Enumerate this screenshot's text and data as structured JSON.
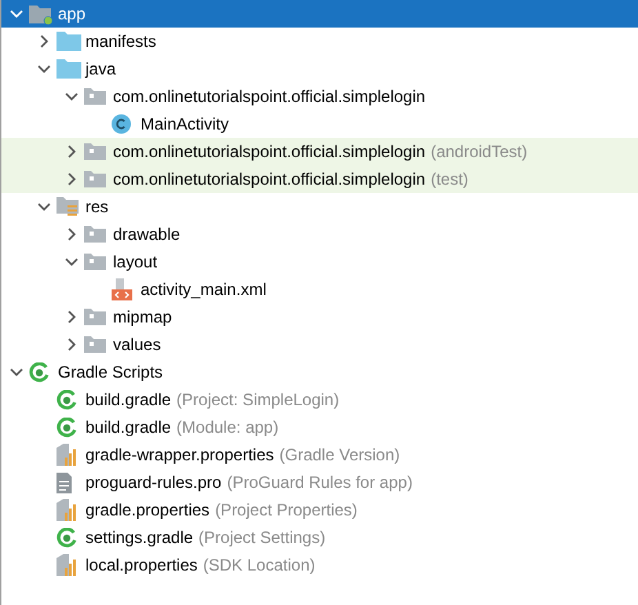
{
  "tree": [
    {
      "label": "app",
      "kind": "module",
      "expanded": true,
      "selected": true,
      "tinted": false,
      "children": [
        {
          "label": "manifests",
          "kind": "source-folder",
          "expanded": false,
          "selected": false,
          "tinted": false
        },
        {
          "label": "java",
          "kind": "source-folder",
          "expanded": true,
          "selected": false,
          "tinted": false,
          "children": [
            {
              "label": "com.onlinetutorialspoint.official.simplelogin",
              "kind": "package",
              "expanded": true,
              "selected": false,
              "tinted": false,
              "children": [
                {
                  "label": "MainActivity",
                  "kind": "class",
                  "selected": false,
                  "tinted": false
                }
              ]
            },
            {
              "label": "com.onlinetutorialspoint.official.simplelogin",
              "hint": "(androidTest)",
              "kind": "package",
              "expanded": false,
              "selected": false,
              "tinted": true
            },
            {
              "label": "com.onlinetutorialspoint.official.simplelogin",
              "hint": "(test)",
              "kind": "package",
              "expanded": false,
              "selected": false,
              "tinted": true
            }
          ]
        },
        {
          "label": "res",
          "kind": "res-folder",
          "expanded": true,
          "selected": false,
          "tinted": false,
          "children": [
            {
              "label": "drawable",
              "kind": "package",
              "expanded": false,
              "selected": false,
              "tinted": false
            },
            {
              "label": "layout",
              "kind": "package",
              "expanded": true,
              "selected": false,
              "tinted": false,
              "children": [
                {
                  "label": "activity_main.xml",
                  "kind": "xml",
                  "selected": false,
                  "tinted": false
                }
              ]
            },
            {
              "label": "mipmap",
              "kind": "package",
              "expanded": false,
              "selected": false,
              "tinted": false
            },
            {
              "label": "values",
              "kind": "package",
              "expanded": false,
              "selected": false,
              "tinted": false
            }
          ]
        }
      ]
    },
    {
      "label": "Gradle Scripts",
      "kind": "gradle",
      "expanded": true,
      "selected": false,
      "tinted": false,
      "children": [
        {
          "label": "build.gradle",
          "hint": "(Project: SimpleLogin)",
          "kind": "gradle",
          "selected": false,
          "tinted": false
        },
        {
          "label": "build.gradle",
          "hint": "(Module: app)",
          "kind": "gradle",
          "selected": false,
          "tinted": false
        },
        {
          "label": "gradle-wrapper.properties",
          "hint": "(Gradle Version)",
          "kind": "properties",
          "selected": false,
          "tinted": false
        },
        {
          "label": "proguard-rules.pro",
          "hint": "(ProGuard Rules for app)",
          "kind": "text-file",
          "selected": false,
          "tinted": false
        },
        {
          "label": "gradle.properties",
          "hint": "(Project Properties)",
          "kind": "properties",
          "selected": false,
          "tinted": false
        },
        {
          "label": "settings.gradle",
          "hint": "(Project Settings)",
          "kind": "gradle",
          "selected": false,
          "tinted": false
        },
        {
          "label": "local.properties",
          "hint": "(SDK Location)",
          "kind": "properties",
          "selected": false,
          "tinted": false
        }
      ]
    }
  ]
}
